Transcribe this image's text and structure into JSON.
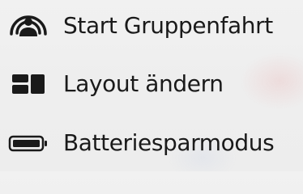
{
  "menu": {
    "items": [
      {
        "label": "Start Gruppenfahrt",
        "icon": "group-ride-icon"
      },
      {
        "label": "Layout ändern",
        "icon": "layout-grid-icon"
      },
      {
        "label": "Batteriesparmodus",
        "icon": "battery-icon"
      }
    ]
  },
  "colors": {
    "text": "#1a1a1a",
    "icon": "#1a1a1a",
    "background": "#eeeeee"
  }
}
